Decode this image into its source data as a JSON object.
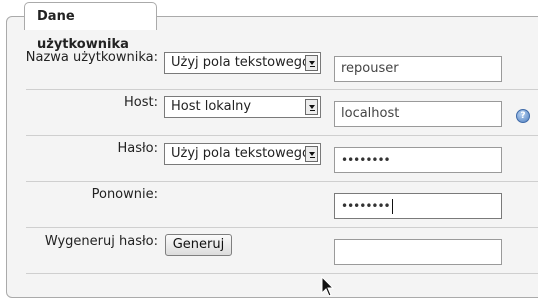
{
  "fieldset": {
    "legend": "Dane użytkownika"
  },
  "rows": {
    "username": {
      "label": "Nazwa użytkownika:",
      "select": "Użyj pola tekstowego:",
      "value": "repouser"
    },
    "host": {
      "label": "Host:",
      "select": "Host lokalny",
      "value": "localhost",
      "help_icon": "help-icon"
    },
    "password": {
      "label": "Hasło:",
      "select": "Użyj pola tekstowego:",
      "value": "••••••••"
    },
    "repeat": {
      "label": "Ponownie:",
      "value": "••••••••"
    },
    "generate": {
      "label": "Wygeneruj hasło:",
      "button": "Generuj",
      "value": ""
    }
  },
  "colors": {
    "panel_bg": "#f4f4f4",
    "border": "#aaaaaa",
    "help_icon": "#4f7fc0"
  }
}
